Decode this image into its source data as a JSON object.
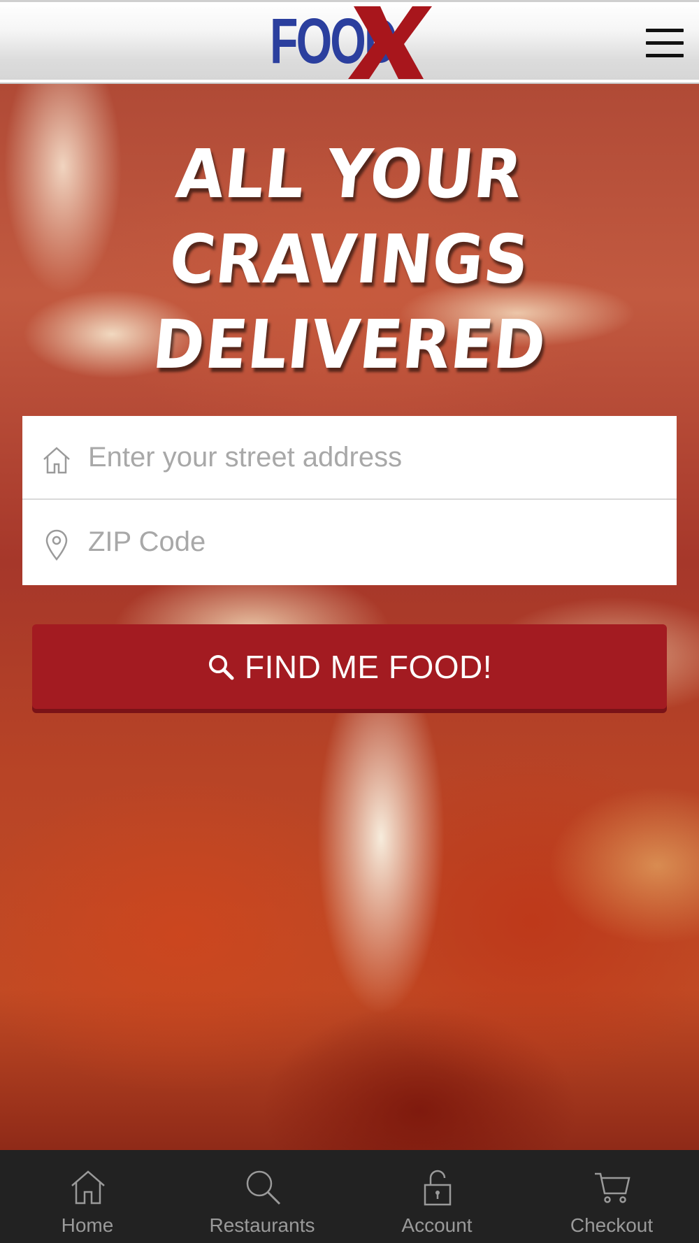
{
  "header": {
    "logo_text": "FOOD",
    "logo_mark": "X",
    "menu_icon": "hamburger-menu-icon"
  },
  "hero": {
    "headline_lines": [
      "ALL YOUR",
      "CRAVINGS",
      "DELIVERED"
    ]
  },
  "form": {
    "address": {
      "placeholder": "Enter your street address",
      "value": "",
      "icon": "home-icon"
    },
    "zip": {
      "placeholder": "ZIP Code",
      "value": "",
      "icon": "map-pin-icon"
    },
    "submit": {
      "label": "FIND ME FOOD!",
      "icon": "search-icon"
    }
  },
  "bottom_nav": {
    "items": [
      {
        "label": "Home",
        "icon": "home-icon"
      },
      {
        "label": "Restaurants",
        "icon": "search-icon"
      },
      {
        "label": "Account",
        "icon": "lock-icon"
      },
      {
        "label": "Checkout",
        "icon": "cart-icon"
      }
    ]
  },
  "colors": {
    "brand_blue": "#2b3f9e",
    "brand_red": "#a31b21",
    "nav_background": "#222222",
    "nav_text": "#9a9a9a",
    "placeholder": "#a8a8a8"
  }
}
